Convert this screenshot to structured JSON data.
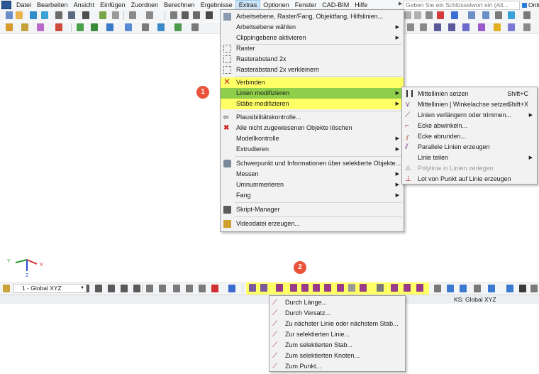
{
  "menubar": {
    "items": [
      "Datei",
      "Bearbeiten",
      "Ansicht",
      "Einfügen",
      "Zuordnen",
      "Berechnen",
      "Ergebnisse",
      "Extras",
      "Optionen",
      "Fenster",
      "CAD-BIM",
      "Hilfe"
    ],
    "active_index": 7,
    "search_placeholder": "Geben Sie ein Schlüsselwort ein (Alt...",
    "online_label": "Onli"
  },
  "extras_menu": {
    "items": [
      {
        "label": "Arbeitsebene, Raster/Fang, Objektfang, Hilfslinien...",
        "icon": "grid-settings-icon",
        "submenu": false
      },
      {
        "label": "Arbeitsebene wählen",
        "icon": "",
        "submenu": true
      },
      {
        "label": "Clippingebene aktivieren",
        "icon": "",
        "submenu": true
      },
      {
        "label": "Raster",
        "icon": "grid-icon",
        "submenu": false
      },
      {
        "label": "Rasterabstand 2x",
        "icon": "grid-double-icon",
        "submenu": false
      },
      {
        "label": "Rasterabstand 2x verkleinern",
        "icon": "grid-half-icon",
        "submenu": false
      },
      {
        "label": "Verbinden",
        "icon": "connect-cross-icon",
        "submenu": false,
        "highlight": "yellow"
      },
      {
        "label": "Linien modifizieren",
        "icon": "",
        "submenu": true,
        "highlight": "green"
      },
      {
        "label": "Stäbe modifizieren",
        "icon": "",
        "submenu": true,
        "highlight": "yellow"
      },
      {
        "label": "Plausibilitätskontrolle...",
        "icon": "glasses-icon",
        "submenu": false
      },
      {
        "label": "Alle nicht zugewiesenen Objekte löschen",
        "icon": "delete-unassigned-icon",
        "submenu": false
      },
      {
        "label": "Modellkontrolle",
        "icon": "",
        "submenu": true
      },
      {
        "label": "Extrudieren",
        "icon": "",
        "submenu": true
      },
      {
        "label": "Schwerpunkt und Informationen über selektierte Objekte...",
        "icon": "centroid-icon",
        "submenu": false
      },
      {
        "label": "Messen",
        "icon": "",
        "submenu": true
      },
      {
        "label": "Umnummerieren",
        "icon": "",
        "submenu": true
      },
      {
        "label": "Fang",
        "icon": "",
        "submenu": true
      },
      {
        "label": "Skript-Manager",
        "icon": "script-icon",
        "submenu": false
      },
      {
        "label": "Videodatei erzeugen...",
        "icon": "video-icon",
        "submenu": false
      }
    ]
  },
  "lines_submenu": {
    "items": [
      {
        "label": "Mittellinien setzen",
        "shortcut": "Shift+C",
        "submenu": false,
        "disabled": false
      },
      {
        "label": "Mittellinien | Winkelachse setzen",
        "shortcut": "Shift+X",
        "submenu": false,
        "disabled": false
      },
      {
        "label": "Linien verlängern oder trimmen...",
        "shortcut": "",
        "submenu": true,
        "disabled": false
      },
      {
        "label": "Ecke abwinkeln...",
        "shortcut": "",
        "submenu": false,
        "disabled": false
      },
      {
        "label": "Ecke abrunden...",
        "shortcut": "",
        "submenu": false,
        "disabled": false
      },
      {
        "label": "Parallele Linien erzeugen",
        "shortcut": "",
        "submenu": false,
        "disabled": false
      },
      {
        "label": "Linie teilen",
        "shortcut": "",
        "submenu": true,
        "disabled": false
      },
      {
        "label": "Polylinie in Linien zerlegen",
        "shortcut": "",
        "submenu": false,
        "disabled": true
      },
      {
        "label": "Lot von Punkt auf Linie erzeugen",
        "shortcut": "",
        "submenu": false,
        "disabled": false
      }
    ]
  },
  "divide_menu": {
    "items": [
      "Durch Länge...",
      "Durch Versatz...",
      "Zu nächster Linie oder nächstem Stab...",
      "Zur selektierten Linie...",
      "Zum selektierten Stab...",
      "Zum selektierten Knoten...",
      "Zum Punkt..."
    ]
  },
  "badges": {
    "one": "1",
    "two": "2"
  },
  "axes": {
    "y": "Y",
    "x": "X",
    "z": "Z"
  },
  "bottom_toolbar": {
    "view_combo": "1 - Global XYZ"
  },
  "statusbar": {
    "coordinate_system": "KS: Global XYZ"
  },
  "colors": {
    "highlight_yellow": "#ffff66",
    "highlight_green": "#8fce4a",
    "badge": "#e8533a",
    "menu_active": "#cce4f7"
  }
}
